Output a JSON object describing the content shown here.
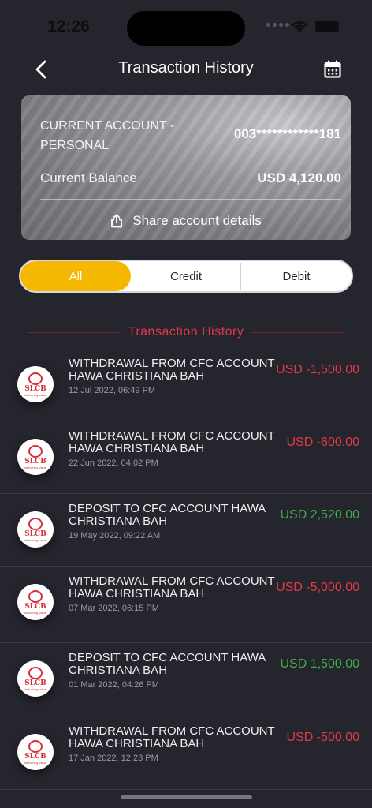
{
  "status_bar": {
    "time": "12:26"
  },
  "header": {
    "title": "Transaction History",
    "back_icon": "chevron-left-icon",
    "calendar_icon": "calendar-icon"
  },
  "account": {
    "name": "CURRENT ACCOUNT - PERSONAL",
    "number": "003************181",
    "balance_label": "Current Balance",
    "balance_value": "USD 4,120.00",
    "share_label": "Share account details",
    "share_icon": "share-icon"
  },
  "tabs": [
    {
      "label": "All",
      "active": true
    },
    {
      "label": "Credit",
      "active": false
    },
    {
      "label": "Debit",
      "active": false
    }
  ],
  "section_title": "Transaction History",
  "logo": {
    "text": "SLCB",
    "tagline": "delivering value"
  },
  "transactions": [
    {
      "description": "WITHDRAWAL FROM CFC ACCOUNT HAWA CHRISTIANA BAH",
      "date": "12 Jul 2022, 06:49 PM",
      "amount": "USD -1,500.00",
      "type": "debit"
    },
    {
      "description": "WITHDRAWAL FROM CFC ACCOUNT HAWA CHRISTIANA BAH",
      "date": "22 Jun 2022, 04:02 PM",
      "amount": "USD -600.00",
      "type": "debit"
    },
    {
      "description": "DEPOSIT TO CFC ACCOUNT HAWA CHRISTIANA BAH",
      "date": "19 May 2022, 09:22 AM",
      "amount": "USD 2,520.00",
      "type": "credit"
    },
    {
      "description": "WITHDRAWAL FROM CFC ACCOUNT HAWA CHRISTIANA BAH",
      "date": "07 Mar 2022, 06:15 PM",
      "amount": "USD -5,000.00",
      "type": "debit"
    },
    {
      "description": "DEPOSIT TO CFC ACCOUNT HAWA CHRISTIANA BAH",
      "date": "01 Mar 2022, 04:26 PM",
      "amount": "USD 1,500.00",
      "type": "credit"
    },
    {
      "description": "WITHDRAWAL FROM CFC ACCOUNT HAWA CHRISTIANA BAH",
      "date": "17 Jan 2022, 12:23 PM",
      "amount": "USD -500.00",
      "type": "debit"
    }
  ],
  "colors": {
    "accent": "#f5b800",
    "debit": "#e23a48",
    "credit": "#3fae4a",
    "background": "#25252d"
  }
}
